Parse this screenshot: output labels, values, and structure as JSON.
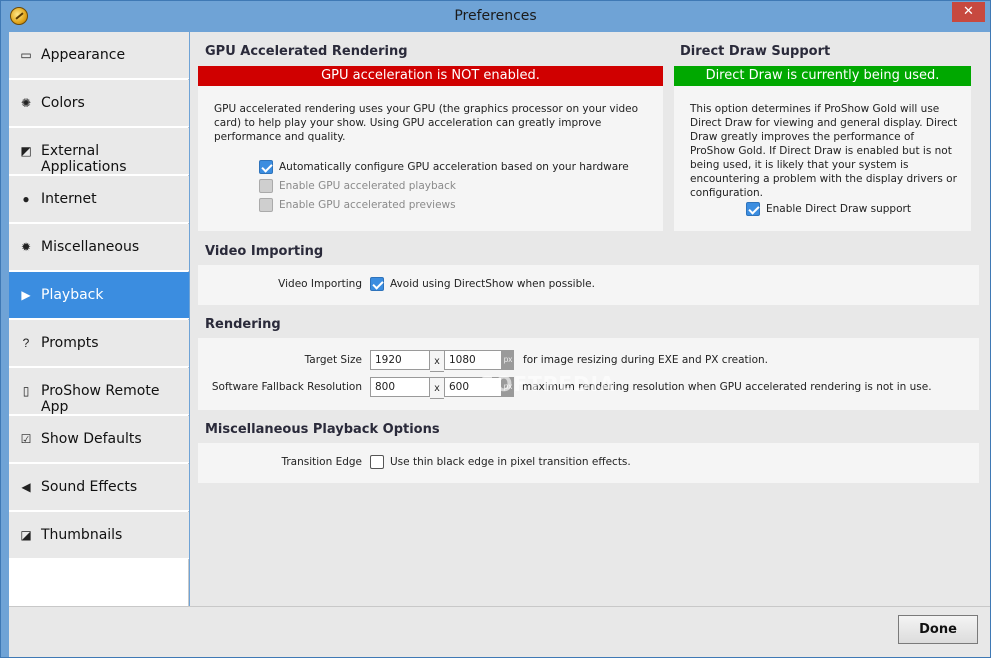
{
  "window": {
    "title": "Preferences",
    "close_label": "✕"
  },
  "sidebar": {
    "items": [
      {
        "label": "Appearance",
        "icon": "window-icon",
        "glyph": "▭"
      },
      {
        "label": "Colors",
        "icon": "palette-icon",
        "glyph": "✺"
      },
      {
        "label": "External Applications",
        "icon": "external-window-icon",
        "glyph": "◩"
      },
      {
        "label": "Internet",
        "icon": "globe-icon",
        "glyph": "●"
      },
      {
        "label": "Miscellaneous",
        "icon": "gear-icon",
        "glyph": "✹"
      },
      {
        "label": "Playback",
        "icon": "play-icon",
        "glyph": "▶"
      },
      {
        "label": "Prompts",
        "icon": "question-icon",
        "glyph": "?"
      },
      {
        "label": "ProShow Remote App",
        "icon": "phone-icon",
        "glyph": "▯"
      },
      {
        "label": "Show Defaults",
        "icon": "checkbox-icon",
        "glyph": "☑"
      },
      {
        "label": "Sound Effects",
        "icon": "speaker-icon",
        "glyph": "◀"
      },
      {
        "label": "Thumbnails",
        "icon": "thumbnail-icon",
        "glyph": "◪"
      }
    ],
    "active_index": 5
  },
  "gpu": {
    "title": "GPU Accelerated Rendering",
    "status": "GPU acceleration is NOT enabled.",
    "status_color": "#d00000",
    "description": "GPU accelerated rendering uses your GPU (the graphics processor on your video card) to help play your show. Using GPU acceleration can greatly improve performance and quality.",
    "options": [
      {
        "label": "Automatically configure GPU acceleration based on your hardware",
        "checked": true,
        "enabled": true
      },
      {
        "label": "Enable GPU accelerated playback",
        "checked": false,
        "enabled": false
      },
      {
        "label": "Enable GPU accelerated previews",
        "checked": false,
        "enabled": false
      }
    ]
  },
  "direct_draw": {
    "title": "Direct Draw Support",
    "status": "Direct Draw is currently being used.",
    "status_color": "#00a800",
    "description": "This option determines if ProShow Gold will use Direct Draw for viewing and general display. Direct Draw greatly improves the performance of ProShow Gold. If Direct Draw is enabled but is not being used, it is likely that your system is encountering a problem with the display drivers or configuration.",
    "option": {
      "label": "Enable Direct Draw support",
      "checked": true
    }
  },
  "video_importing": {
    "title": "Video Importing",
    "field_label": "Video Importing",
    "option": {
      "label": "Avoid using DirectShow when possible.",
      "checked": true
    }
  },
  "rendering": {
    "title": "Rendering",
    "target_size": {
      "label": "Target Size",
      "width": "1920",
      "height": "1080",
      "x": "x",
      "unit": "px",
      "note": "for image resizing during EXE and PX creation."
    },
    "fallback": {
      "label": "Software Fallback Resolution",
      "width": "800",
      "height": "600",
      "x": "x",
      "unit": "px",
      "note": "maximum rendering resolution when GPU accelerated rendering is not in use."
    }
  },
  "misc_playback": {
    "title": "Miscellaneous Playback Options",
    "field_label": "Transition Edge",
    "option": {
      "label": "Use thin black edge in pixel transition effects.",
      "checked": false
    }
  },
  "footer": {
    "done_label": "Done"
  },
  "watermark": "SOFTPEDIA"
}
